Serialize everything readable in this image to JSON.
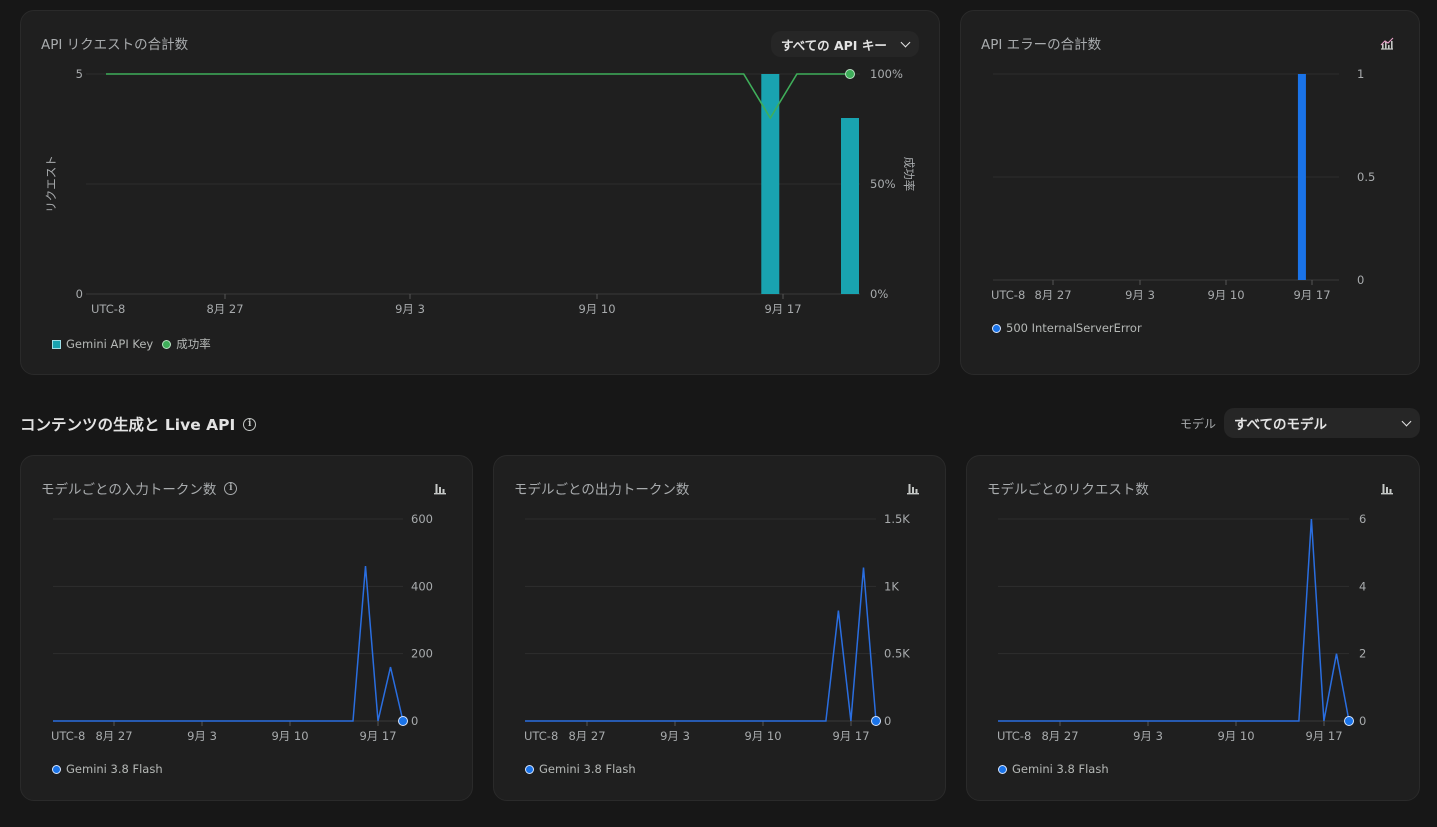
{
  "colors": {
    "teal": "#19a3b0",
    "green": "#3fae5a",
    "blue": "#1a73e8",
    "line_blue": "#2a6ee0"
  },
  "cards": {
    "requests": {
      "title": "API リクエストの合計数",
      "key_select": "すべての API キー",
      "y_left_label": "リクエスト",
      "y_right_label": "成功率",
      "legend": [
        "Gemini API Key",
        "成功率"
      ]
    },
    "errors": {
      "title": "API エラーの合計数",
      "legend": [
        "500 InternalServerError"
      ]
    },
    "input_tokens": {
      "title": "モデルごとの入力トークン数",
      "legend": [
        "Gemini 3.8 Flash"
      ]
    },
    "output_tokens": {
      "title": "モデルごとの出力トークン数",
      "legend": [
        "Gemini 3.8 Flash"
      ]
    },
    "model_requests": {
      "title": "モデルごとのリクエスト数",
      "legend": [
        "Gemini 3.8 Flash"
      ]
    }
  },
  "section": {
    "title": "コンテンツの生成と Live API",
    "model_label": "モデル",
    "model_select": "すべてのモデル"
  },
  "chart_data": [
    {
      "id": "requests",
      "type": "bar",
      "title": "API リクエストの合計数",
      "ylabel": "リクエスト",
      "y2label": "成功率",
      "x_first_label": "UTC-8",
      "x_ticks": [
        "8月 27",
        "9月 3",
        "9月 10",
        "9月 17"
      ],
      "y_ticks": [
        "0",
        "5"
      ],
      "y2_ticks": [
        "0%",
        "50%",
        "100%"
      ],
      "ylim": [
        0,
        5
      ],
      "y2lim": [
        0,
        100
      ],
      "series": [
        {
          "name": "Gemini API Key",
          "kind": "bar",
          "x": [
            25,
            28
          ],
          "values": [
            5,
            4
          ]
        },
        {
          "name": "成功率",
          "kind": "line",
          "x": [
            0,
            24,
            25,
            26,
            28
          ],
          "values": [
            100,
            100,
            80,
            100,
            100
          ]
        }
      ],
      "days": 28
    },
    {
      "id": "errors",
      "type": "bar",
      "title": "API エラーの合計数",
      "x_first_label": "UTC-8",
      "x_ticks": [
        "8月 27",
        "9月 3",
        "9月 10",
        "9月 17"
      ],
      "y_ticks": [
        "0",
        "0.5",
        "1"
      ],
      "ylim": [
        0,
        1
      ],
      "series": [
        {
          "name": "500 InternalServerError",
          "x": [
            25
          ],
          "values": [
            1
          ]
        }
      ],
      "days": 28
    },
    {
      "id": "input_tokens",
      "type": "line",
      "title": "モデルごとの入力トークン数",
      "x_first_label": "UTC-8",
      "x_ticks": [
        "8月 27",
        "9月 3",
        "9月 10",
        "9月 17"
      ],
      "y_ticks": [
        "0",
        "200",
        "400",
        "600"
      ],
      "ylim": [
        0,
        600
      ],
      "series": [
        {
          "name": "Gemini 3.8 Flash",
          "x": [
            0,
            24,
            25,
            26,
            27,
            28
          ],
          "values": [
            0,
            0,
            460,
            0,
            160,
            0
          ]
        }
      ],
      "days": 28
    },
    {
      "id": "output_tokens",
      "type": "line",
      "title": "モデルごとの出力トークン数",
      "x_first_label": "UTC-8",
      "x_ticks": [
        "8月 27",
        "9月 3",
        "9月 10",
        "9月 17"
      ],
      "y_ticks": [
        "0",
        "0.5K",
        "1K",
        "1.5K"
      ],
      "ylim": [
        0,
        1500
      ],
      "series": [
        {
          "name": "Gemini 3.8 Flash",
          "x": [
            0,
            24,
            25,
            26,
            27,
            28
          ],
          "values": [
            0,
            0,
            820,
            0,
            1140,
            0
          ]
        }
      ],
      "days": 28
    },
    {
      "id": "model_requests",
      "type": "line",
      "title": "モデルごとのリクエスト数",
      "x_first_label": "UTC-8",
      "x_ticks": [
        "8月 27",
        "9月 3",
        "9月 10",
        "9月 17"
      ],
      "y_ticks": [
        "0",
        "2",
        "4",
        "6"
      ],
      "ylim": [
        0,
        6
      ],
      "series": [
        {
          "name": "Gemini 3.8 Flash",
          "x": [
            0,
            24,
            25,
            26,
            27,
            28
          ],
          "values": [
            0,
            0,
            6,
            0,
            2,
            0
          ]
        }
      ],
      "days": 28
    }
  ]
}
